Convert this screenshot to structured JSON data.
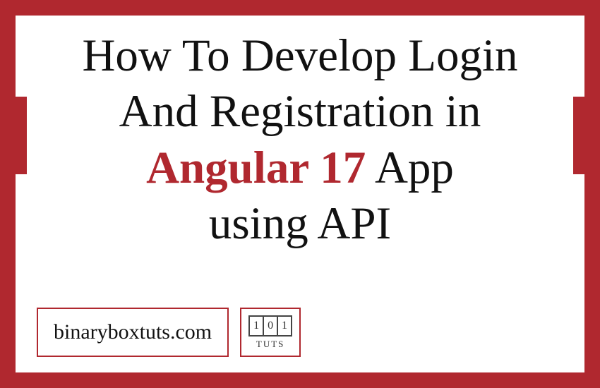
{
  "title": {
    "line1": "How To Develop Login",
    "line2": "And Registration in",
    "line3_highlight": "Angular 17",
    "line3_rest": " App",
    "line4": "using API"
  },
  "footer": {
    "site": "binaryboxtuts.com",
    "logo_digits": [
      "1",
      "0",
      "1"
    ],
    "logo_label": "TUTS"
  },
  "colors": {
    "accent": "#b0282f",
    "text": "#111111"
  }
}
